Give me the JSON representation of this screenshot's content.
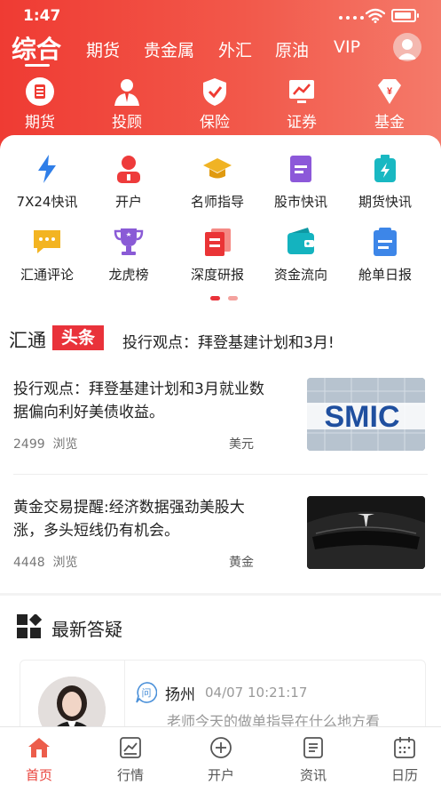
{
  "status_bar": {
    "time": "1:47"
  },
  "top_tabs": [
    {
      "label": "综合",
      "active": true
    },
    {
      "label": "期货"
    },
    {
      "label": "贵金属"
    },
    {
      "label": "外汇"
    },
    {
      "label": "原油"
    },
    {
      "label": "VIP"
    }
  ],
  "quick_menu": [
    {
      "label": "期货",
      "icon": "futures-icon"
    },
    {
      "label": "投顾",
      "icon": "advisor-icon"
    },
    {
      "label": "保险",
      "icon": "insurance-icon"
    },
    {
      "label": "证券",
      "icon": "securities-icon"
    },
    {
      "label": "基金",
      "icon": "fund-icon"
    }
  ],
  "feature_grid": [
    {
      "label": "7X24快讯",
      "icon": "flash-news-icon"
    },
    {
      "label": "开户",
      "icon": "open-account-icon"
    },
    {
      "label": "名师指导",
      "icon": "graduation-cap-icon"
    },
    {
      "label": "股市快讯",
      "icon": "stock-news-icon"
    },
    {
      "label": "期货快讯",
      "icon": "futures-news-icon"
    },
    {
      "label": "汇通评论",
      "icon": "comment-icon"
    },
    {
      "label": "龙虎榜",
      "icon": "trophy-icon"
    },
    {
      "label": "深度研报",
      "icon": "research-report-icon"
    },
    {
      "label": "资金流向",
      "icon": "wallet-icon"
    },
    {
      "label": "舱单日报",
      "icon": "daily-report-icon"
    }
  ],
  "headline": {
    "brand": "汇通",
    "badge": "头条",
    "ticker": "投行观点：拜登基建计划和3月!"
  },
  "news": [
    {
      "title": "投行观点：拜登基建计划和3月就业数据偏向利好美债收益。",
      "views": "2499",
      "views_label": "浏览",
      "tag": "美元",
      "thumb_text": "SMIC"
    },
    {
      "title": "黄金交易提醒:经济数据强劲美股大涨，多头短线仍有机会。",
      "views": "4448",
      "views_label": "浏览",
      "tag": "黄金",
      "thumb_text": ""
    }
  ],
  "qa": {
    "title": "最新答疑",
    "city": "扬州",
    "time": "04/07 10:21:17",
    "question": "老师今天的做单指导在什么地方看",
    "q_icon_text": "问"
  },
  "bottom_nav": [
    {
      "label": "首页",
      "icon": "home-icon",
      "active": true
    },
    {
      "label": "行情",
      "icon": "market-icon"
    },
    {
      "label": "开户",
      "icon": "plus-circle-icon"
    },
    {
      "label": "资讯",
      "icon": "news-icon"
    },
    {
      "label": "日历",
      "icon": "calendar-icon"
    }
  ],
  "colors": {
    "brand_red": "#e9323a",
    "header_start": "#ef3b33",
    "header_end": "#f47a6a"
  }
}
